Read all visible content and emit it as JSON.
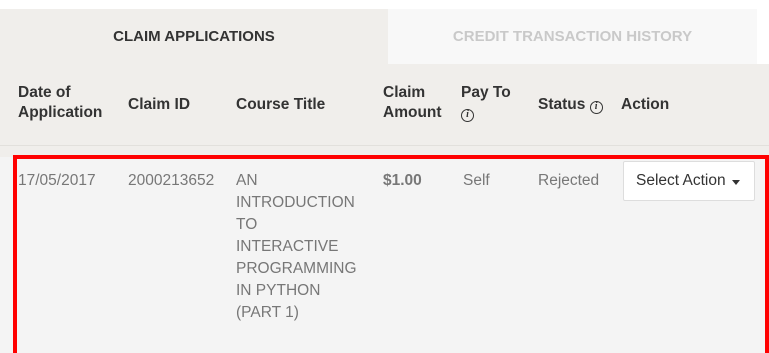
{
  "tabs": [
    {
      "label": "CLAIM APPLICATIONS",
      "active": true
    },
    {
      "label": "CREDIT TRANSACTION HISTORY",
      "active": false
    }
  ],
  "table": {
    "headers": {
      "date_line1": "Date of",
      "date_line2": "Application",
      "claim_id": "Claim ID",
      "course_title": "Course Title",
      "claim_line1": "Claim",
      "claim_line2": "Amount",
      "pay_to": "Pay To",
      "status": "Status",
      "action": "Action"
    },
    "rows": [
      {
        "date": "17/05/2017",
        "claim_id": "2000213652",
        "course_title_lines": [
          "AN",
          "INTRODUCTION",
          "TO",
          "INTERACTIVE",
          "PROGRAMMING",
          "IN PYTHON",
          "(PART 1)"
        ],
        "amount": "$1.00",
        "pay_to": "Self",
        "status": "Rejected",
        "action_label": "Select Action"
      }
    ]
  },
  "colors": {
    "highlight": "#ff0000",
    "header_bg": "#f0eeeb",
    "inactive_tab_text": "#c9c9c9"
  },
  "icons": {
    "info": "info-icon",
    "caret": "caret-down-icon"
  }
}
